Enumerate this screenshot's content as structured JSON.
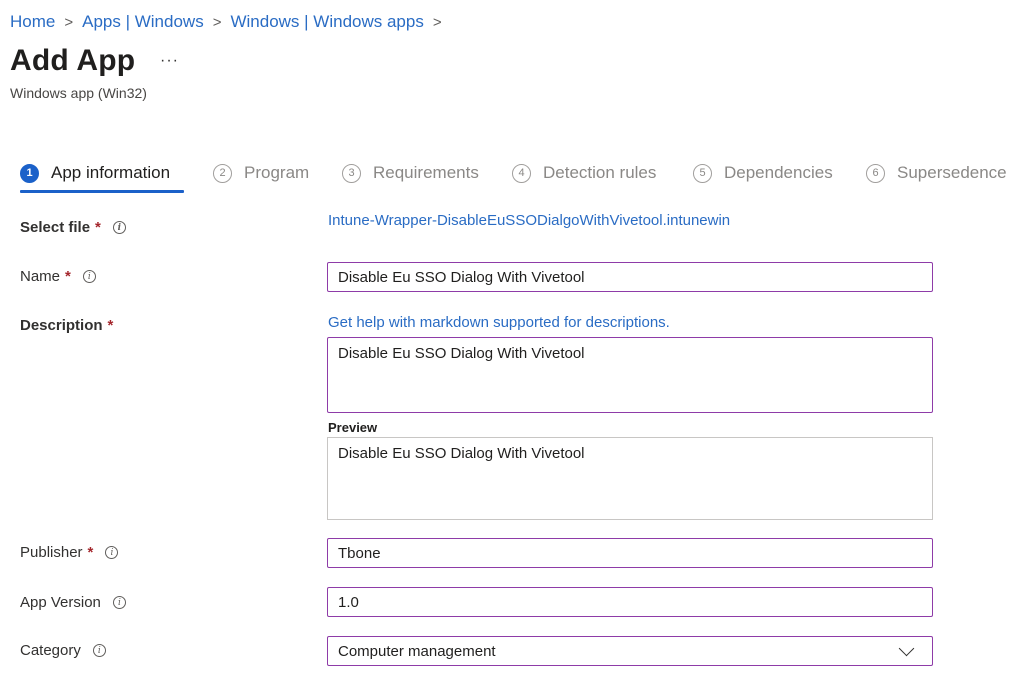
{
  "breadcrumb": {
    "items": [
      "Home",
      "Apps | Windows",
      "Windows | Windows apps"
    ],
    "separator": ">"
  },
  "header": {
    "title": "Add App",
    "more": "···",
    "subtitle": "Windows app (Win32)"
  },
  "steps": [
    {
      "num": "1",
      "label": "App information"
    },
    {
      "num": "2",
      "label": "Program"
    },
    {
      "num": "3",
      "label": "Requirements"
    },
    {
      "num": "4",
      "label": "Detection rules"
    },
    {
      "num": "5",
      "label": "Dependencies"
    },
    {
      "num": "6",
      "label": "Supersedence"
    }
  ],
  "form": {
    "required_mark": "*",
    "info_glyph": "i",
    "select_file": {
      "label": "Select file",
      "value": "Intune-Wrapper-DisableEuSSODialgoWithVivetool.intunewin"
    },
    "name": {
      "label": "Name",
      "value": "Disable Eu SSO Dialog With Vivetool"
    },
    "description": {
      "label": "Description",
      "help_link": "Get help with markdown supported for descriptions.",
      "value": "Disable Eu SSO Dialog With Vivetool",
      "preview_label": "Preview",
      "preview_value": "Disable Eu SSO Dialog With Vivetool"
    },
    "publisher": {
      "label": "Publisher",
      "value": "Tbone"
    },
    "app_version": {
      "label": "App Version",
      "value": "1.0"
    },
    "category": {
      "label": "Category",
      "value": "Computer management"
    }
  },
  "colors": {
    "accent": "#1b61c9",
    "link": "#2a6cc4",
    "required": "#a4262c",
    "input_border": "#8e3ba8"
  }
}
